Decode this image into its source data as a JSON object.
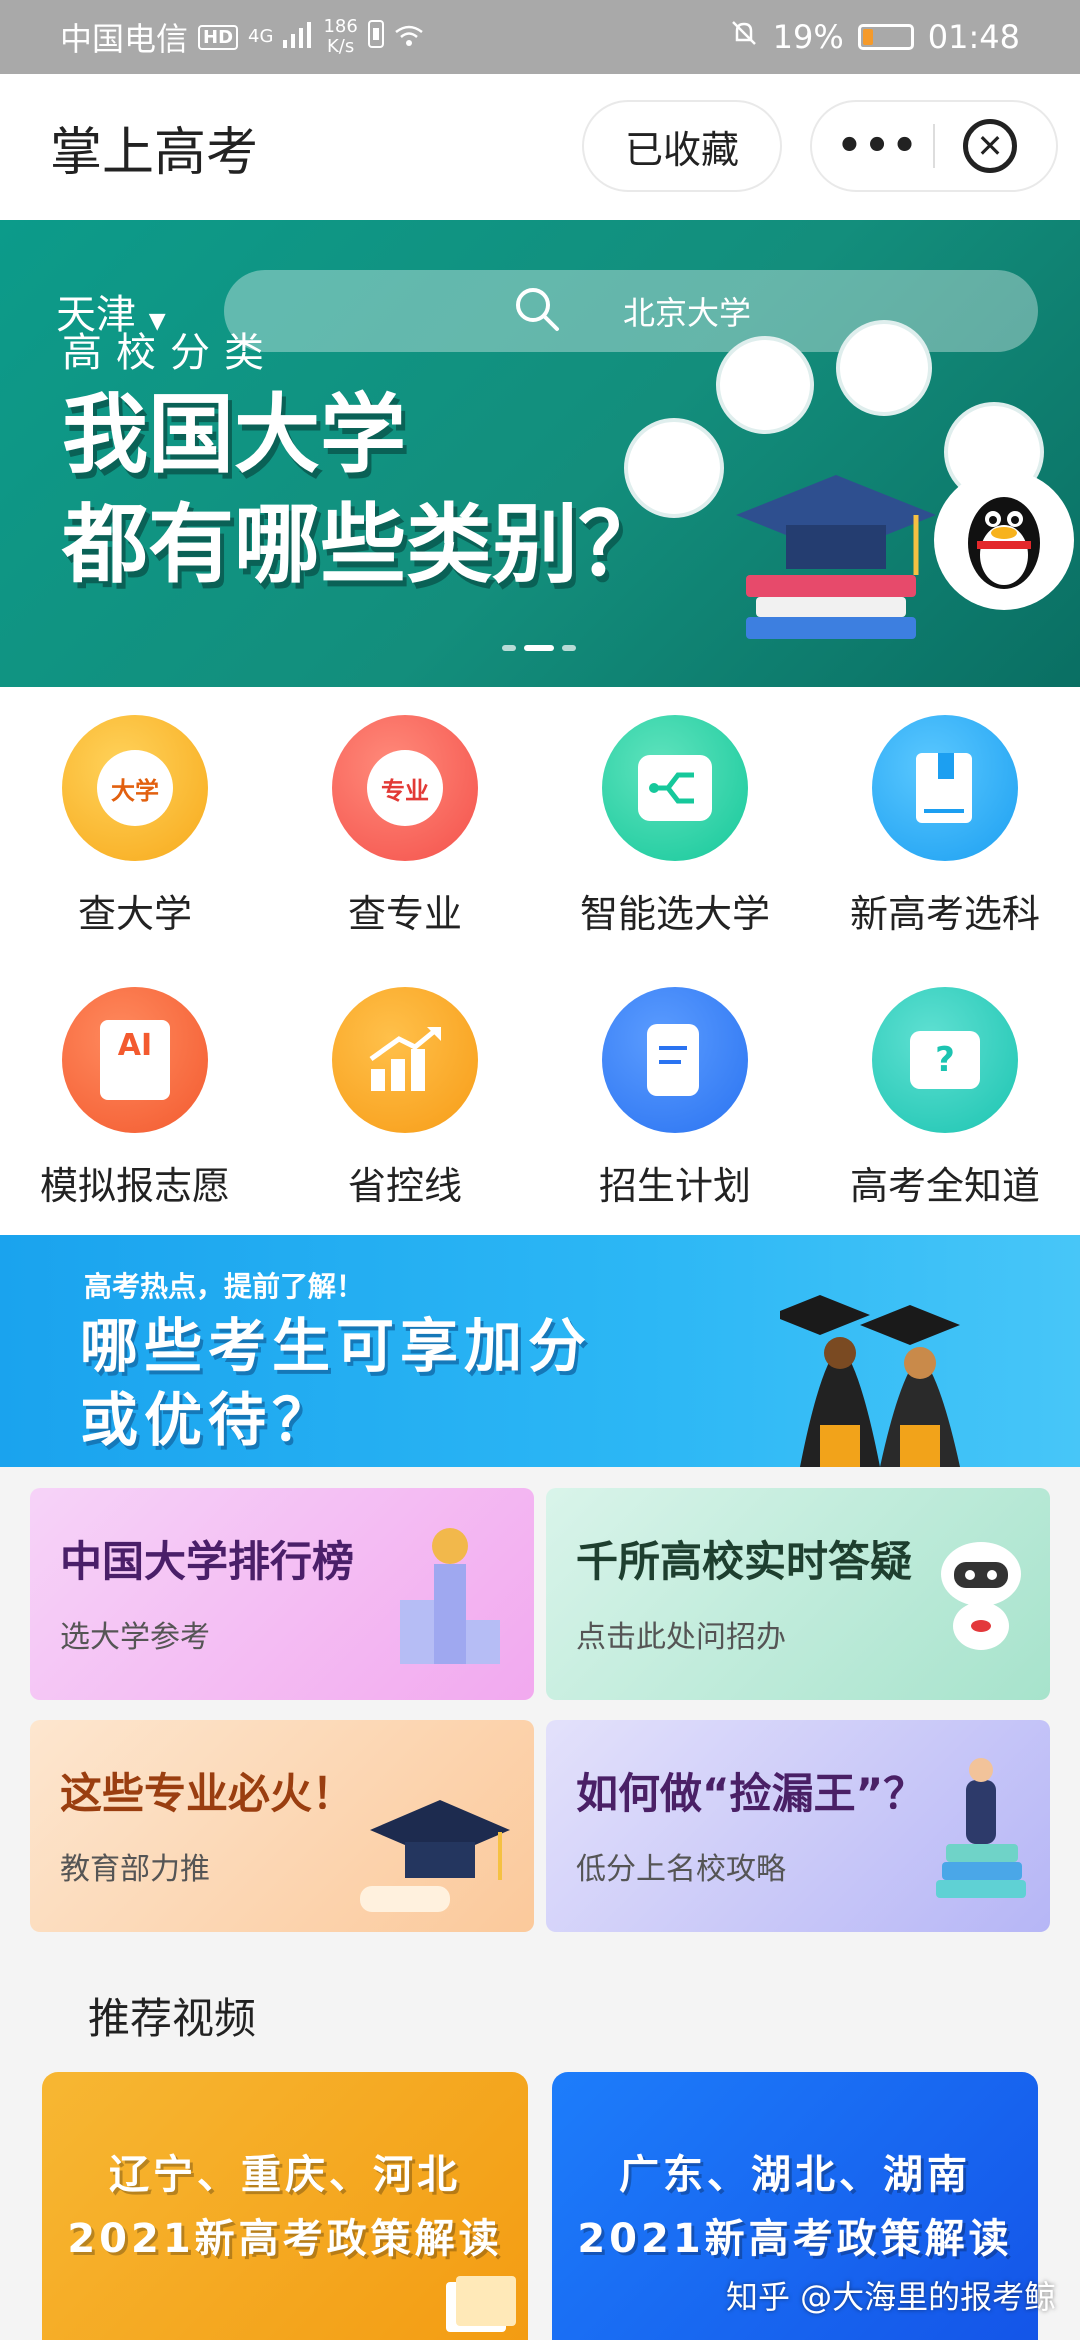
{
  "status_bar": {
    "carrier": "中国电信",
    "hd": "HD",
    "network": "4G",
    "speed_value": "186",
    "speed_unit": "K/s",
    "battery_percent": "19%",
    "time": "01:48"
  },
  "app_bar": {
    "title": "掌上高考",
    "favorited_label": "已收藏",
    "more_label": "•••"
  },
  "hero": {
    "city": "天津",
    "search_placeholder": "北京大学",
    "tagline": "高校分类",
    "headline_line1": "我国大学",
    "headline_line2": "都有哪些类别？"
  },
  "grid": {
    "items": [
      {
        "label": "查大学",
        "icon": "university-icon",
        "icon_text": "大学",
        "color": "#f7a91b"
      },
      {
        "label": "查专业",
        "icon": "major-icon",
        "icon_text": "专业",
        "color": "#f4514b"
      },
      {
        "label": "智能选大学",
        "icon": "smart-select-icon",
        "color": "#16c89b"
      },
      {
        "label": "新高考选科",
        "icon": "book-icon",
        "color": "#1c9ff1"
      },
      {
        "label": "模拟报志愿",
        "icon": "ai-application-icon",
        "icon_text": "AI",
        "color": "#f35a2f"
      },
      {
        "label": "省控线",
        "icon": "score-line-chart-icon",
        "color": "#f79c17"
      },
      {
        "label": "招生计划",
        "icon": "plan-scroll-icon",
        "color": "#2a73f1"
      },
      {
        "label": "高考全知道",
        "icon": "question-chat-icon",
        "icon_text": "?",
        "color": "#1cc4b1"
      }
    ]
  },
  "promo": {
    "kicker": "高考热点，提前了解！",
    "line1": "哪些考生可享加分",
    "line2": "或优待？"
  },
  "cards": [
    {
      "title": "中国大学排行榜",
      "subtitle": "选大学参考"
    },
    {
      "title": "千所高校实时答疑",
      "subtitle": "点击此处问招办"
    },
    {
      "title": "这些专业必火！",
      "subtitle": "教育部力推"
    },
    {
      "title": "如何做“捡漏王”？",
      "subtitle": "低分上名校攻略"
    }
  ],
  "videos_section": {
    "title": "推荐视频",
    "items": [
      {
        "line1": "辽宁、重庆、河北",
        "line2": "2021新高考政策解读"
      },
      {
        "line1": "广东、湖北、湖南",
        "line2": "2021新高考政策解读"
      }
    ]
  },
  "watermark": "知乎 @大海里的报考鲸"
}
